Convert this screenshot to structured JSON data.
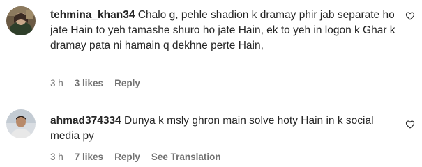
{
  "comments": [
    {
      "username": "tehmina_khan34",
      "text": "Chalo g, pehle shadion k dramay phir jab separate ho jate Hain to yeh tamashe shuro ho jate Hain, ek to yeh in logon k Ghar k dramay pata ni hamain q dekhne perte Hain,",
      "time": "3 h",
      "likes": "3 likes",
      "reply": "Reply",
      "translation": ""
    },
    {
      "username": "ahmad374334",
      "text": "Dunya k msly ghron main solve hoty Hain in k social media py",
      "time": "3 h",
      "likes": "7 likes",
      "reply": "Reply",
      "translation": "See Translation"
    }
  ],
  "icons": {
    "like": "heart-outline-icon"
  },
  "colors": {
    "text": "#262626",
    "meta": "#737373"
  }
}
